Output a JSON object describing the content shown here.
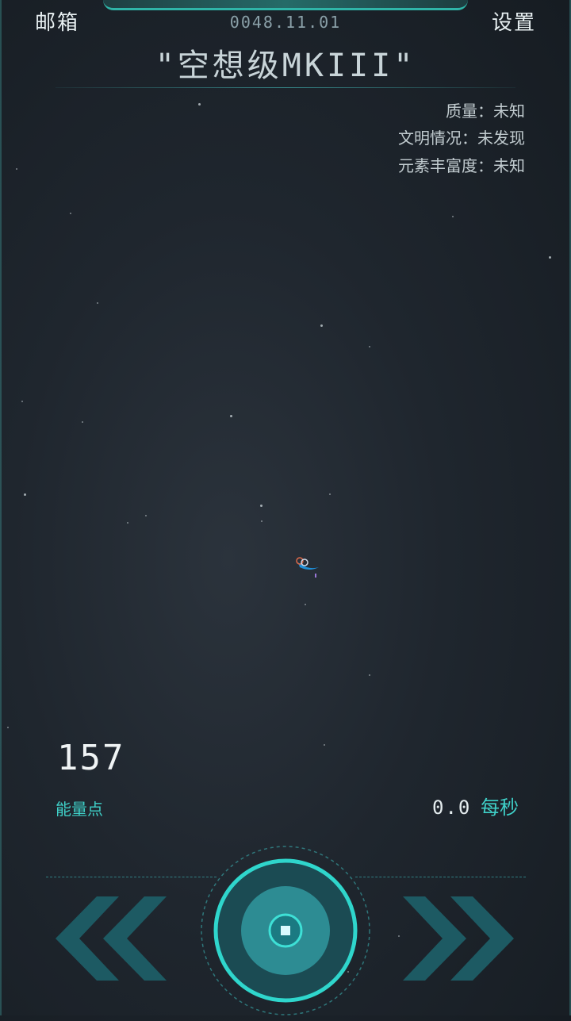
{
  "header": {
    "mail_label": "邮箱",
    "settings_label": "设置",
    "date": "0048.11.01",
    "planet_name": "\"空想级MKIII\""
  },
  "planet_info": {
    "mass": "质量：未知",
    "civilization": "文明情况：未发现",
    "element_abundance": "元素丰富度：未知"
  },
  "stats": {
    "energy_points": "157",
    "energy_label": "能量点",
    "rate_value": "0.0",
    "rate_unit": "每秒"
  },
  "controls": {
    "left_icon": "double-chevron-left-icon",
    "center_icon": "core-button-icon",
    "right_icon": "double-chevron-right-icon"
  },
  "colors": {
    "accent": "#3fd0c8",
    "frame": "#2fb5a8",
    "background": "#1f262e"
  }
}
